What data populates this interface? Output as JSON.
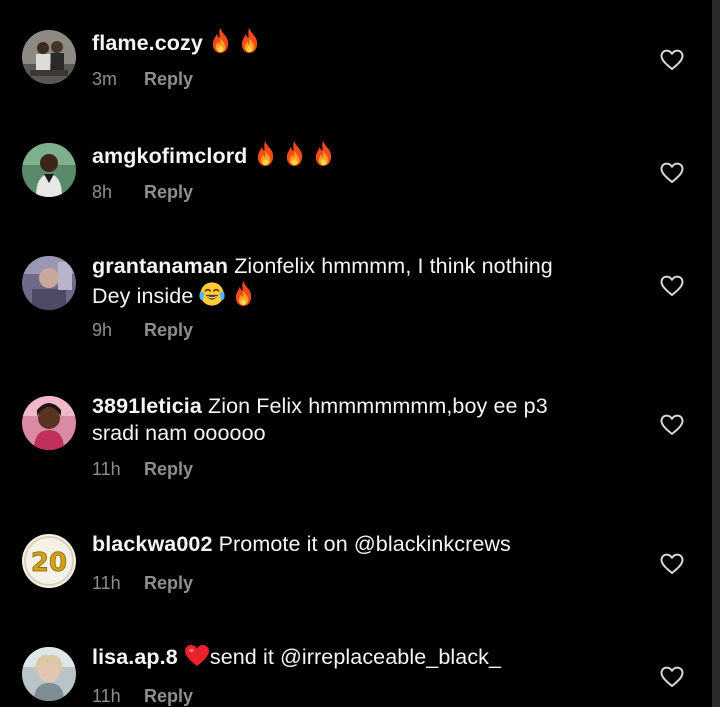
{
  "colors": {
    "background": "#000000",
    "text": "#f5f5f5",
    "meta": "#8e8e8e"
  },
  "actions": {
    "reply_label": "Reply"
  },
  "comments": [
    {
      "username": "flame.cozy",
      "text_line1": "",
      "text_line2": "",
      "emojis": [
        "fire",
        "fire"
      ],
      "time": "3m",
      "avatar_icon": "user-avatar-photo"
    },
    {
      "username": "amgkofimclord",
      "text_line1": "",
      "text_line2": "",
      "emojis": [
        "fire",
        "fire",
        "fire"
      ],
      "time": "8h",
      "avatar_icon": "user-avatar-photo"
    },
    {
      "username": "grantanaman",
      "text_line1": "Zionfelix hmmmm, I think nothing",
      "text_line2": "Dey inside",
      "emojis": [
        "tears-of-joy",
        "fire"
      ],
      "time": "9h",
      "avatar_icon": "user-avatar-photo"
    },
    {
      "username": "3891leticia",
      "text_line1": "Zion Felix hmmmmmmm,boy ee p3",
      "text_line2": "sradi nam oooooo",
      "emojis": [],
      "time": "11h",
      "avatar_icon": "user-avatar-photo"
    },
    {
      "username": "blackwa002",
      "text_line1": "Promote it on @blackinkcrews",
      "text_line2": "",
      "emojis": [],
      "time": "11h",
      "avatar_icon": "user-avatar-20-logo"
    },
    {
      "username": "lisa.ap.8",
      "text_line1": "send it @irreplaceable_black_",
      "text_line2": "",
      "emojis": [
        "red-heart"
      ],
      "time": "11h",
      "avatar_icon": "user-avatar-photo"
    }
  ]
}
